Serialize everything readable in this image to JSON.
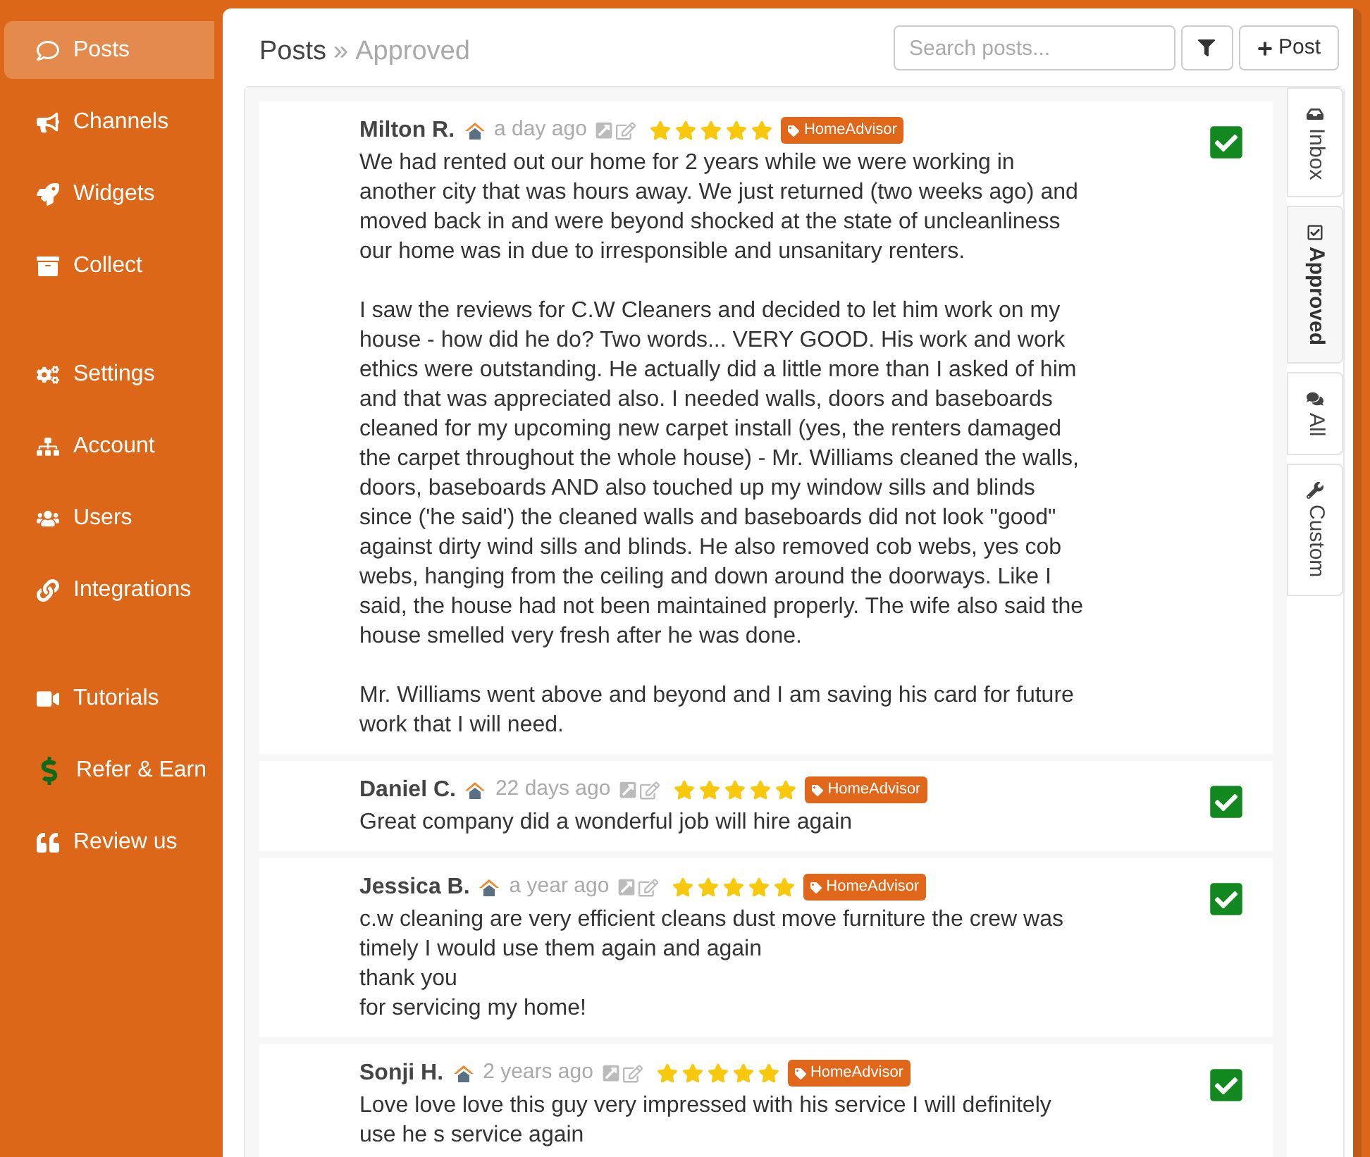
{
  "sidebar": {
    "groups": [
      [
        {
          "label": "Posts",
          "selected": true
        },
        {
          "label": "Channels",
          "selected": false
        },
        {
          "label": "Widgets",
          "selected": false
        },
        {
          "label": "Collect",
          "selected": false
        }
      ],
      [
        {
          "label": "Settings",
          "selected": false
        },
        {
          "label": "Account",
          "selected": false
        },
        {
          "label": "Users",
          "selected": false
        },
        {
          "label": "Integrations",
          "selected": false
        }
      ],
      [
        {
          "label": "Tutorials",
          "selected": false
        },
        {
          "label": "Refer & Earn",
          "selected": false
        },
        {
          "label": "Review us",
          "selected": false
        }
      ]
    ]
  },
  "header": {
    "title": "Posts",
    "separator": "»",
    "subtitle": "Approved",
    "search": {
      "placeholder": "Search posts..."
    },
    "add_button": "Post"
  },
  "reviews": [
    {
      "name": "Milton R.",
      "time": "a day ago",
      "stars": 5,
      "tag": "HomeAdvisor",
      "approved": true,
      "paragraphs": [
        [
          "We had rented out our home for 2 years while we were working in another city that was hours away. We just returned (two weeks ago) and moved back in and were beyond shocked at the state of uncleanliness our home was in due to irresponsible and unsanitary renters."
        ],
        [
          "I saw the reviews for C.W Cleaners and decided to let him work on my house - how did he do? Two words... VERY GOOD. His work and work ethics were outstanding. He actually did a little more than I asked of him and that was appreciated also. I needed walls, doors and baseboards cleaned for my upcoming new carpet install (yes, the renters damaged the carpet throughout the whole house) - Mr. Williams cleaned the walls, doors, baseboards AND also touched up my window sills and blinds since ('he said') the cleaned walls and baseboards did not look \"good\" against dirty wind sills and blinds. He also removed cob webs, yes cob webs, hanging from the ceiling and down around the doorways. Like I said, the house had not been maintained properly. The wife also said the house smelled very fresh after he was done."
        ],
        [
          "Mr. Williams went above and beyond and I am saving his card for future work that I will need."
        ]
      ]
    },
    {
      "name": "Daniel C.",
      "time": "22 days ago",
      "stars": 5,
      "tag": "HomeAdvisor",
      "approved": true,
      "paragraphs": [
        [
          "Great company did a wonderful job will hire again"
        ]
      ]
    },
    {
      "name": "Jessica B.",
      "time": "a year ago",
      "stars": 5,
      "tag": "HomeAdvisor",
      "approved": true,
      "paragraphs": [
        [
          "c.w cleaning are very efficient cleans dust move furniture the crew was timely I would use them again and again",
          "thank you",
          "for servicing my home!"
        ]
      ]
    },
    {
      "name": "Sonji H.",
      "time": "2 years ago",
      "stars": 5,
      "tag": "HomeAdvisor",
      "approved": true,
      "paragraphs": [
        [
          "Love love love this guy very impressed with his service I will definitely use he s service again"
        ]
      ]
    }
  ],
  "tabs": [
    {
      "label": "Inbox",
      "selected": false
    },
    {
      "label": "Approved",
      "selected": true
    },
    {
      "label": "All",
      "selected": false
    },
    {
      "label": "Custom",
      "selected": false
    }
  ]
}
